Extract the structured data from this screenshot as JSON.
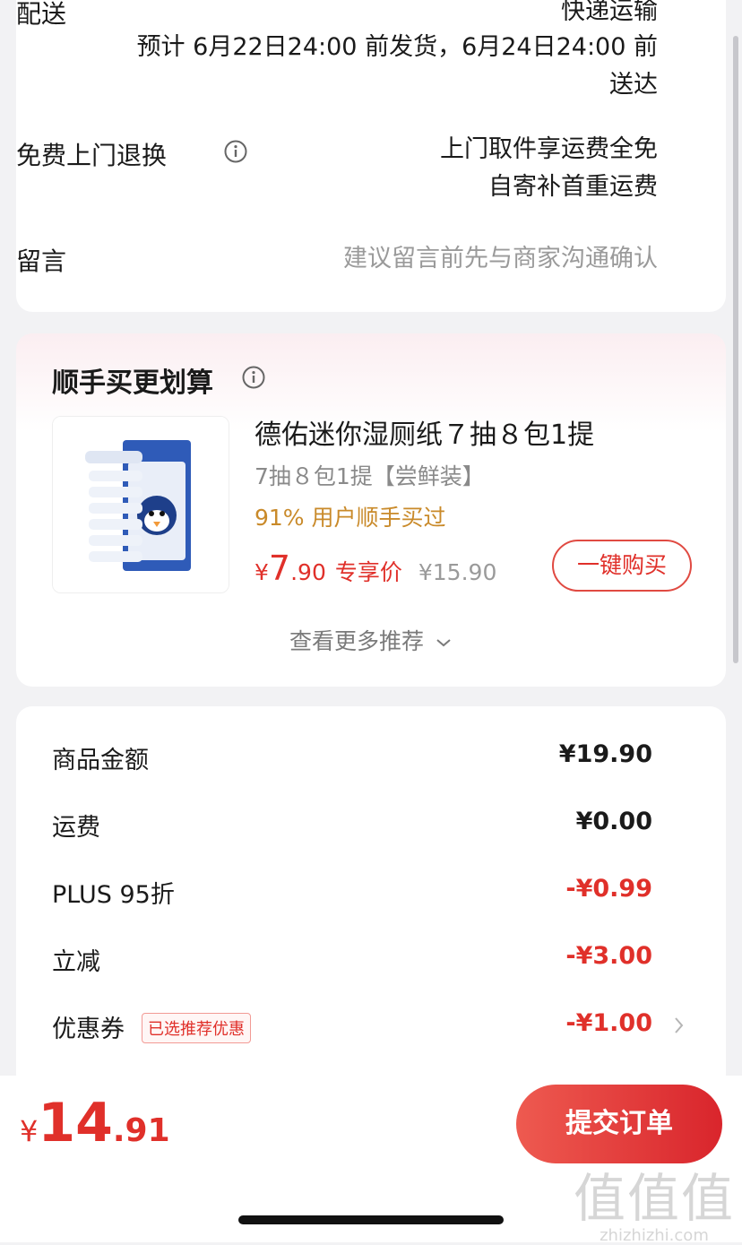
{
  "delivery": {
    "label": "配送",
    "method": "快递运输",
    "estimate_line1": "预计 6月22日24:00 前发货，6月24日24:00 前",
    "estimate_line2": "送达"
  },
  "returns": {
    "label": "免费上门退换",
    "info_icon": "info-icon",
    "line1": "上门取件享运费全免",
    "line2": "自寄补首重运费"
  },
  "message": {
    "label": "留言",
    "placeholder": "建议留言前先与商家沟通确认"
  },
  "recommend": {
    "title": "顺手买更划算",
    "info_icon": "info-icon",
    "product": {
      "name": "德佑迷你湿厕纸７抽８包1提",
      "spec": "7抽８包1提【尝鲜装】",
      "social": "91% 用户顺手买过",
      "price_currency": "¥",
      "price_int": "7",
      "price_dec": ".90",
      "price_label": "专享价",
      "original_price": "¥15.90",
      "buy_label": "一键购买"
    },
    "more_label": "查看更多推荐",
    "more_icon": "chevron-down-icon"
  },
  "summary": {
    "rows": [
      {
        "label": "商品金额",
        "value": "¥19.90"
      },
      {
        "label": "运费",
        "value": "¥0.00"
      },
      {
        "label": "PLUS 95折",
        "value": "-¥0.99"
      },
      {
        "label": "立减",
        "value": "-¥3.00"
      },
      {
        "label": "优惠券",
        "value": "-¥1.00"
      }
    ],
    "coupon_tag": "已选推荐优惠",
    "coupon_icon": "chevron-right-icon"
  },
  "footer": {
    "total_currency": "¥",
    "total_int": "14",
    "total_dec": ".91",
    "submit_label": "提交订单"
  },
  "watermark": {
    "logo": "值值值",
    "url": "zhizhizhi.com"
  },
  "colors": {
    "accent": "#e0302a",
    "social": "#c98a2a",
    "muted": "#9a9a9a",
    "background": "#f2f2f4"
  }
}
